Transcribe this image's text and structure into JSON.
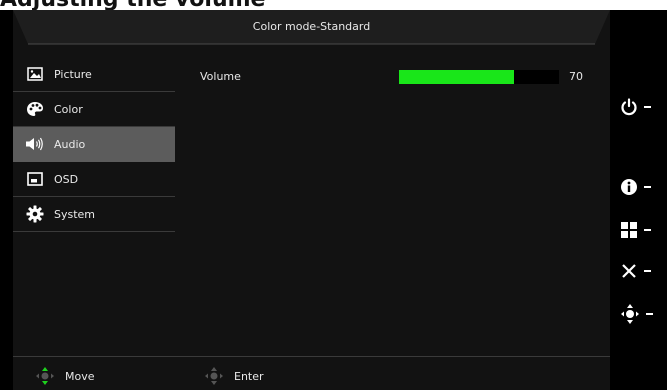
{
  "page_caption": "Adjusting the volume",
  "header": {
    "title": "Color mode-Standard"
  },
  "menu": {
    "items": [
      {
        "label": "Picture",
        "icon": "picture-icon",
        "active": false
      },
      {
        "label": "Color",
        "icon": "palette-icon",
        "active": false
      },
      {
        "label": "Audio",
        "icon": "speaker-icon",
        "active": true
      },
      {
        "label": "OSD",
        "icon": "osd-icon",
        "active": false
      },
      {
        "label": "System",
        "icon": "gear-icon",
        "active": false
      }
    ]
  },
  "content": {
    "volume_label": "Volume",
    "volume_value": "70",
    "volume_level": 0.72
  },
  "footer": {
    "move_label": "Move",
    "enter_label": "Enter"
  },
  "side_buttons": [
    "power-icon",
    "info-icon",
    "menu-grid-icon",
    "close-icon",
    "navigation-joystick-icon"
  ],
  "colors": {
    "panel_background": "#121212",
    "active_item": "#5c5c5c",
    "volume_bar": "#19e619",
    "joystick_green": "#1ed21e"
  }
}
